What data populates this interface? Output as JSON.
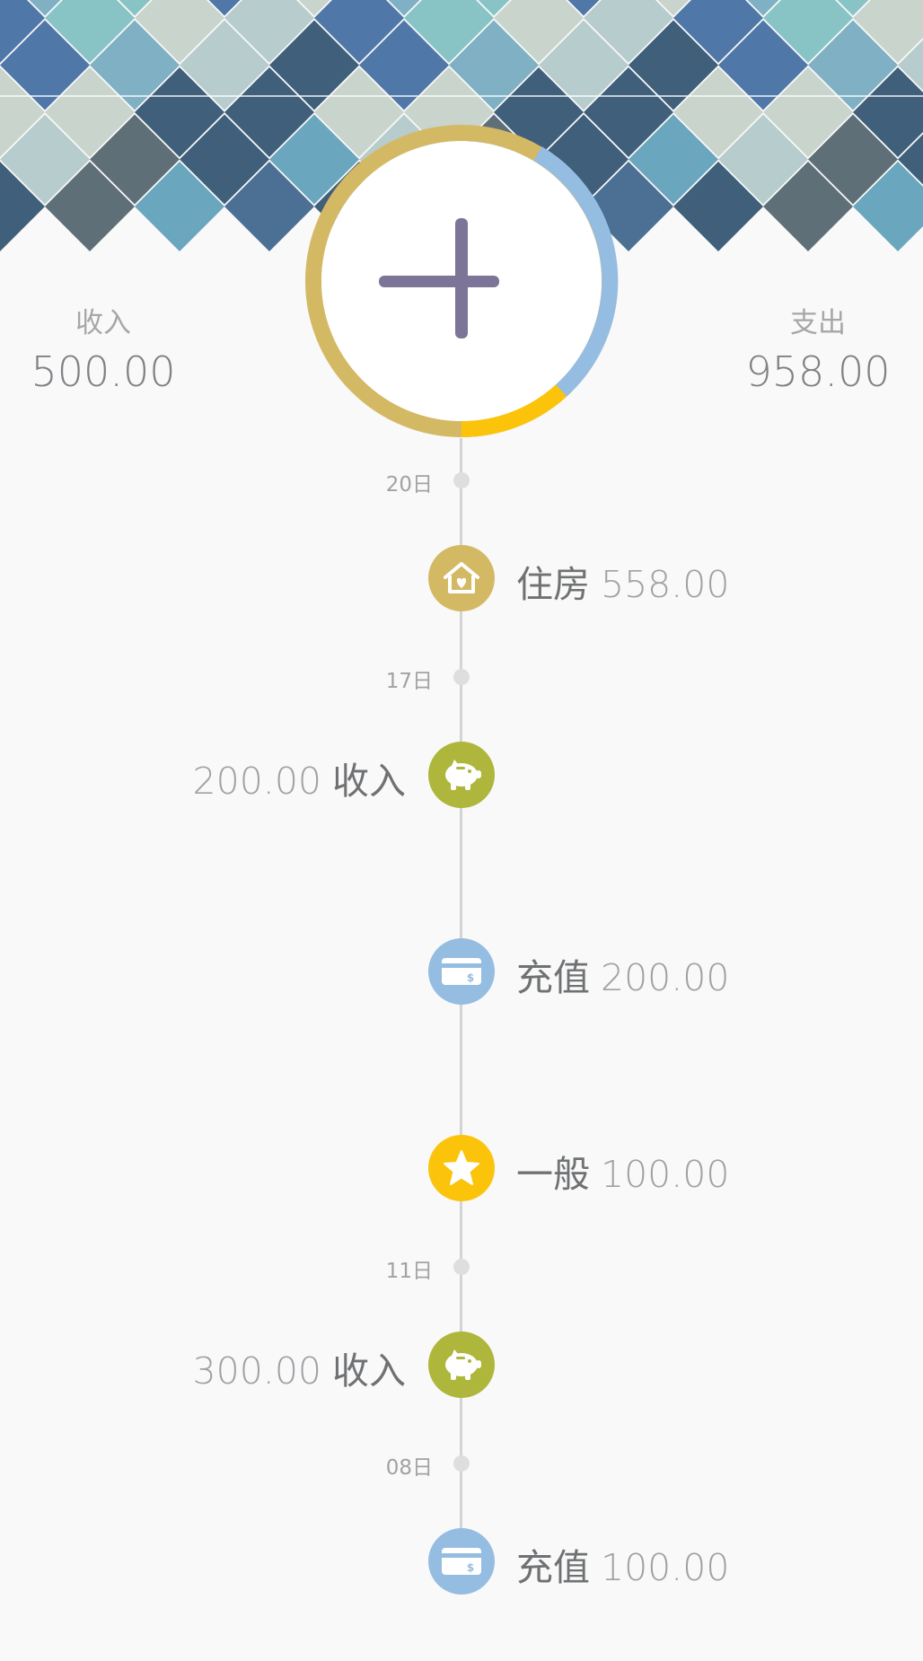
{
  "summary": {
    "income_label": "收入",
    "income_value": "500.00",
    "expense_label": "支出",
    "expense_value": "958.00"
  },
  "colors": {
    "housing": "#d4b965",
    "income": "#aeb63b",
    "topup": "#95bde2",
    "general": "#fbc40a",
    "plus": "#7c7597"
  },
  "timeline": {
    "dates": [
      "20日",
      "17日",
      "11日",
      "08日"
    ],
    "entries": [
      {
        "category": "住房",
        "amount": "558.00",
        "icon": "house-heart-icon"
      },
      {
        "category": "收入",
        "amount": "200.00",
        "icon": "piggy-bank-icon"
      },
      {
        "category": "充值",
        "amount": "200.00",
        "icon": "credit-card-icon"
      },
      {
        "category": "一般",
        "amount": "100.00",
        "icon": "star-icon"
      },
      {
        "category": "收入",
        "amount": "300.00",
        "icon": "piggy-bank-icon"
      },
      {
        "category": "充值",
        "amount": "100.00",
        "icon": "credit-card-icon"
      }
    ]
  }
}
